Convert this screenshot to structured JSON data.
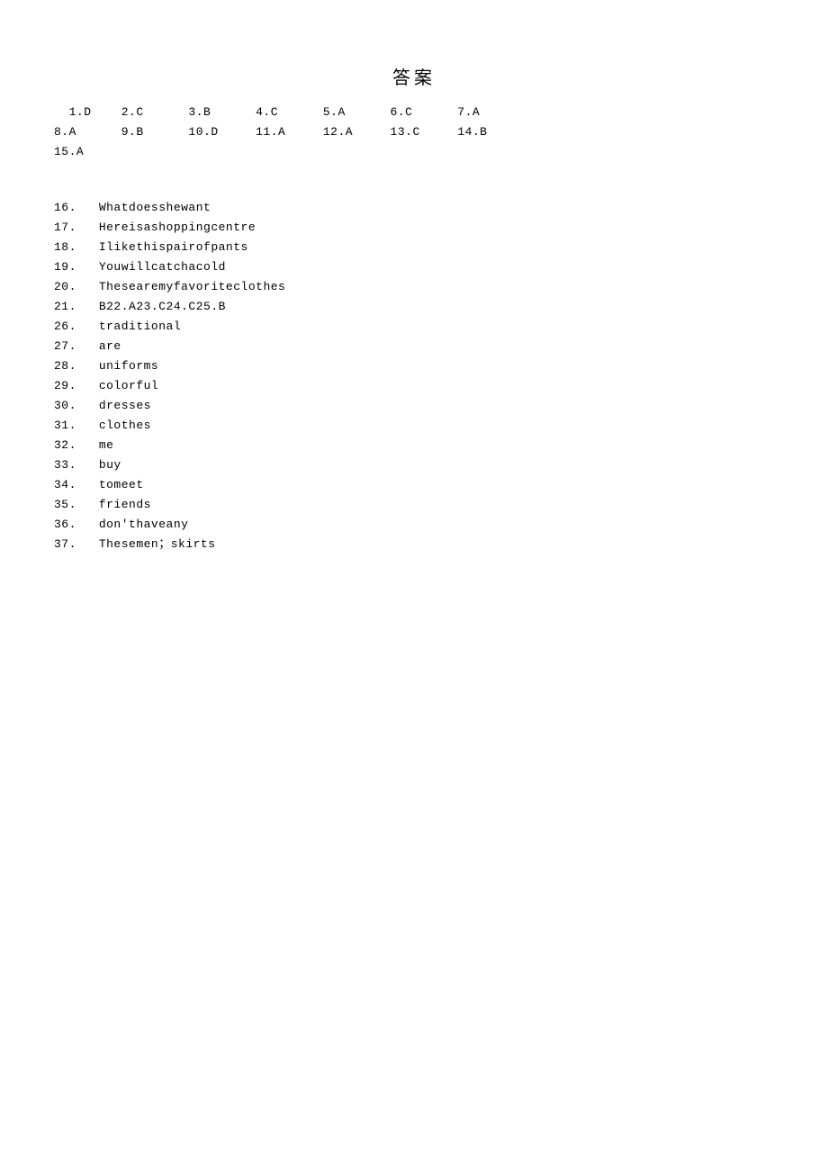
{
  "title": "答案",
  "mc": {
    "row1": [
      {
        "n": "1",
        "pre": "  ",
        "a": "D"
      },
      {
        "n": "2",
        "a": "C"
      },
      {
        "n": "3",
        "a": "B"
      },
      {
        "n": "4",
        "a": "C"
      },
      {
        "n": "5",
        "a": "A"
      },
      {
        "n": "6",
        "a": "C"
      },
      {
        "n": "7",
        "a": "A"
      }
    ],
    "row2": [
      {
        "n": "8",
        "pre": "",
        "a": "A"
      },
      {
        "n": "9",
        "a": "B"
      },
      {
        "n": "10",
        "a": "D"
      },
      {
        "n": "11",
        "a": "A"
      },
      {
        "n": "12",
        "a": "A"
      },
      {
        "n": "13",
        "a": "C"
      },
      {
        "n": "14",
        "a": "B"
      }
    ],
    "row3": [
      {
        "n": "15",
        "pre": "",
        "a": "A"
      }
    ]
  },
  "list_items": [
    {
      "n": "16",
      "text": "Whatdoesshewant"
    },
    {
      "n": "17",
      "text": "Hereisashoppingcentre"
    },
    {
      "n": "18",
      "text": "Ilikethispairofpants"
    },
    {
      "n": "19",
      "text": "Youwillcatchacold"
    },
    {
      "n": "20",
      "text": "Thesearemyfavoriteclothes"
    },
    {
      "n": "21",
      "text": "B22.A23.C24.C25.B"
    },
    {
      "n": "26",
      "text": "traditional"
    },
    {
      "n": "27",
      "text": "are"
    },
    {
      "n": "28",
      "text": "uniforms"
    },
    {
      "n": "29",
      "text": "colorful"
    },
    {
      "n": "30",
      "text": "dresses"
    },
    {
      "n": "31",
      "text": "clothes"
    },
    {
      "n": "32",
      "text": "me"
    },
    {
      "n": "33",
      "text": "buy"
    },
    {
      "n": "34",
      "text": "tomeet"
    },
    {
      "n": "35",
      "text": "friends"
    },
    {
      "n": "36",
      "text": "don'thaveany"
    },
    {
      "n": "37",
      "text": "Thesemen；skirts"
    }
  ]
}
